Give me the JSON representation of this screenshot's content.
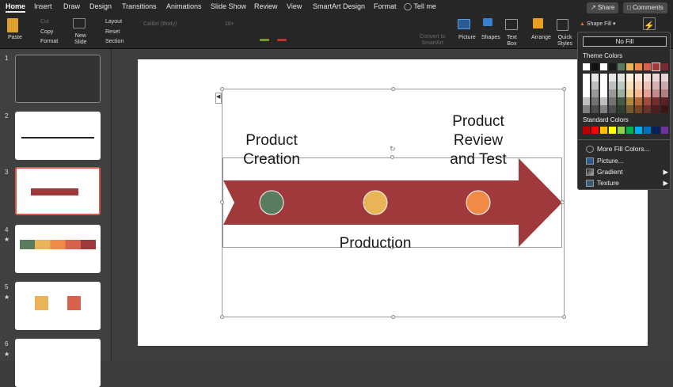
{
  "tabs": [
    "Home",
    "Insert",
    "Draw",
    "Design",
    "Transitions",
    "Animations",
    "Slide Show",
    "Review",
    "View",
    "SmartArt Design",
    "Format",
    "Tell me"
  ],
  "top_buttons": {
    "share": "Share",
    "comments": "Comments"
  },
  "ribbon": {
    "paste": "Paste",
    "cut": "Cut",
    "copy": "Copy",
    "format": "Format",
    "new_slide": "New\nSlide",
    "layout": "Layout",
    "reset": "Reset",
    "section": "Section",
    "font": "Calibri (Body)",
    "font_size": "18+",
    "convert": "Convert to\nSmartArt",
    "picture": "Picture",
    "shapes": "Shapes",
    "text_box": "Text\nBox",
    "arrange": "Arrange",
    "quick_styles": "Quick\nStyles",
    "shape_fill": "Shape Fill"
  },
  "slides": [
    {
      "number": "1",
      "star": false
    },
    {
      "number": "2",
      "star": false
    },
    {
      "number": "3",
      "star": false,
      "selected": true
    },
    {
      "number": "4",
      "star": true
    },
    {
      "number": "5",
      "star": true
    },
    {
      "number": "6",
      "star": true
    }
  ],
  "slide": {
    "label1": "Product\nCreation",
    "label2": "Product\nReview\nand Test",
    "label3": "Production",
    "arrow_color": "#a0393c",
    "circle_colors": [
      "#5b7b5f",
      "#e8b455",
      "#f08a46"
    ]
  },
  "fill_menu": {
    "no_fill": "No Fill",
    "theme_title": "Theme Colors",
    "theme_colors": [
      "#ffffff",
      "#111111",
      "#ffffff",
      "#1a1a1a",
      "#5b7b5f",
      "#e8b455",
      "#f08a46",
      "#d8614e",
      "#a0393c",
      "#7a2a2e"
    ],
    "standard_title": "Standard Colors",
    "standard_colors": [
      "#c00000",
      "#ff0000",
      "#ffc000",
      "#ffff00",
      "#92d050",
      "#00b050",
      "#00b0f0",
      "#0070c0",
      "#002060",
      "#7030a0"
    ],
    "items": [
      {
        "label": "More Fill Colors...",
        "icon": "palette-icon",
        "submenu": false
      },
      {
        "label": "Picture...",
        "icon": "picture-icon",
        "submenu": false
      },
      {
        "label": "Gradient",
        "icon": "gradient-icon",
        "submenu": true
      },
      {
        "label": "Texture",
        "icon": "texture-icon",
        "submenu": true
      }
    ]
  }
}
